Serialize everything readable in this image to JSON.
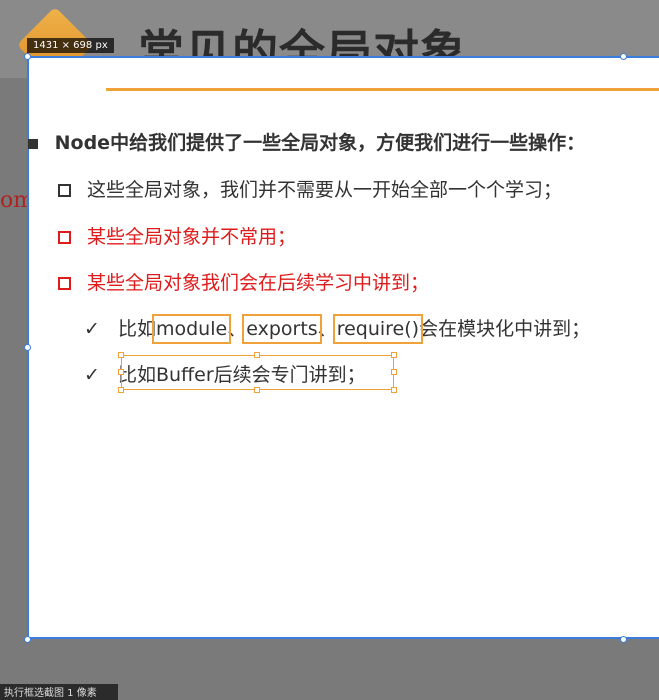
{
  "slide": {
    "title": "常见的全局对象",
    "side_text": "om"
  },
  "capture": {
    "size_label": "1431 × 698",
    "size_unit": "px"
  },
  "content": {
    "heading": "Node中给我们提供了一些全局对象，方便我们进行一些操作：",
    "item1": "这些全局对象，我们并不需要从一开始全部一个个学习；",
    "item2": "某些全局对象并不常用；",
    "item3": "某些全局对象我们会在后续学习中讲到；",
    "sub1_prefix": "比如",
    "sub1_module": "module",
    "sub1_sep1": "、",
    "sub1_exports": "exports",
    "sub1_sep2": "、",
    "sub1_require": "require()",
    "sub1_suffix": "会在模块化中讲到；",
    "sub2_prefix": "比",
    "sub2_selected": "如Buffer后续会专门讲到；"
  },
  "status_bar": {
    "text": "执行框选截图 1 像素"
  },
  "colors": {
    "capture_border": "#3b7ddd",
    "accent_orange": "#f0a23a",
    "emphasis_red": "#e01b1b"
  }
}
